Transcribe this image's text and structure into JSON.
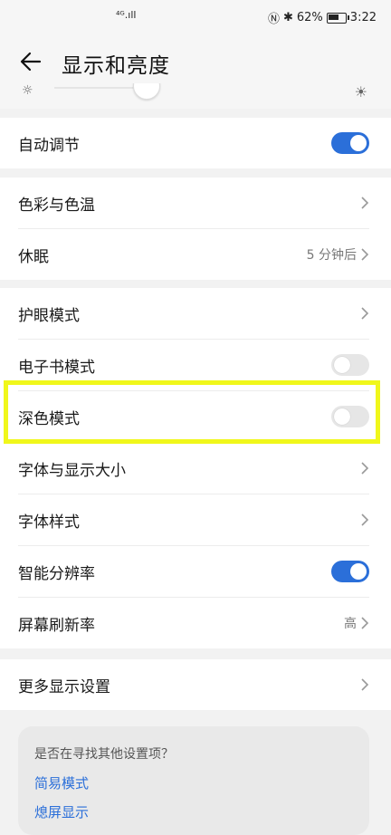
{
  "status_bar": {
    "signal": "⁴ᴳ.ıll",
    "battery_percent": "62%",
    "time": "3:22"
  },
  "header": {
    "title": "显示和亮度"
  },
  "brightness": {
    "level": 0.25
  },
  "sections": [
    {
      "rows": [
        {
          "label": "自动调节",
          "control": "toggle",
          "on": true
        }
      ]
    },
    {
      "rows": [
        {
          "label": "色彩与色温",
          "control": "chevron"
        },
        {
          "label": "休眠",
          "control": "chevron",
          "value": "5 分钟后"
        }
      ]
    },
    {
      "rows": [
        {
          "label": "护眼模式",
          "control": "chevron"
        },
        {
          "label": "电子书模式",
          "control": "toggle",
          "on": false
        },
        {
          "label": "深色模式",
          "control": "toggle",
          "on": false
        },
        {
          "label": "字体与显示大小",
          "control": "chevron"
        },
        {
          "label": "字体样式",
          "control": "chevron"
        },
        {
          "label": "智能分辨率",
          "control": "toggle",
          "on": true
        },
        {
          "label": "屏幕刷新率",
          "control": "chevron",
          "value": "高"
        }
      ]
    },
    {
      "rows": [
        {
          "label": "更多显示设置",
          "control": "chevron"
        }
      ]
    }
  ],
  "suggestions": {
    "question": "是否在寻找其他设置项？",
    "links": [
      "简易模式",
      "熄屏显示"
    ]
  },
  "colors": {
    "accent": "#2b6fd9",
    "highlight": "#f0f71b"
  }
}
